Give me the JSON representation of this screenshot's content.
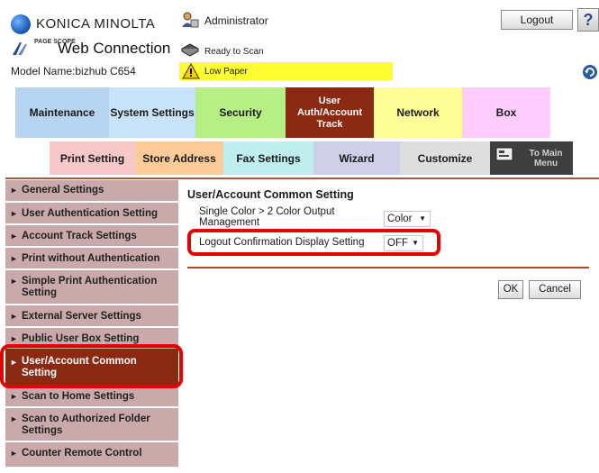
{
  "header": {
    "brand_name": "KONICA MINOLTA",
    "logo_text": "PAGE SCOPE",
    "app_title": "Web Connection",
    "model_name": "Model Name:bizhub C654",
    "user": "Administrator",
    "scan_status": "Ready to Scan",
    "warning": "Low Paper",
    "warning_color": "#ffff33",
    "logout_label": "Logout",
    "help_label": "?"
  },
  "tabs": [
    {
      "label": "Maintenance",
      "color": "#b7d4f0"
    },
    {
      "label": "System Settings",
      "color": "#c8e2f7"
    },
    {
      "label": "Security",
      "color": "#b6ef84"
    },
    {
      "label": "User\nAuth/Account\nTrack",
      "color": "#8b2a12",
      "active": true
    },
    {
      "label": "Network",
      "color": "#ffff99"
    },
    {
      "label": "Box",
      "color": "#ffccff"
    }
  ],
  "subtabs": [
    {
      "label": "Print Setting"
    },
    {
      "label": "Store Address"
    },
    {
      "label": "Fax Settings"
    },
    {
      "label": "Wizard"
    },
    {
      "label": "Customize"
    },
    {
      "label": "To Main Menu"
    }
  ],
  "sidebar": {
    "items": [
      {
        "label": "General Settings"
      },
      {
        "label": "User Authentication Setting"
      },
      {
        "label": "Account Track Settings"
      },
      {
        "label": "Print without Authentication"
      },
      {
        "label": "Simple Print Authentication Setting"
      },
      {
        "label": "External Server Settings"
      },
      {
        "label": "Public User Box Setting"
      },
      {
        "label": "User/Account Common Setting",
        "active": true
      },
      {
        "label": "Scan to Home Settings"
      },
      {
        "label": "Scan to Authorized Folder Settings"
      },
      {
        "label": "Counter Remote Control"
      }
    ]
  },
  "main": {
    "title": "User/Account Common Setting",
    "rows": [
      {
        "label": "Single Color > 2 Color Output Management",
        "value": "Color"
      },
      {
        "label": "Logout Confirmation Display Setting",
        "value": "OFF"
      }
    ],
    "ok_label": "OK",
    "cancel_label": "Cancel"
  },
  "colors": {
    "accent": "#8b2a12",
    "sidebar_bg": "#c9a9a9",
    "highlight": "#e30000"
  }
}
